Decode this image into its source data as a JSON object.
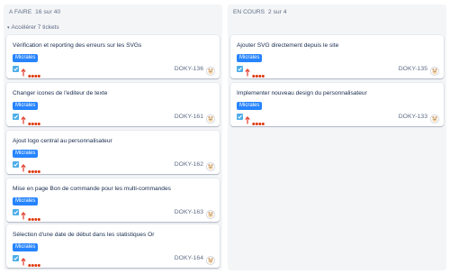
{
  "columns": [
    {
      "title": "A FAIRE",
      "count": "16 sur 40",
      "accelerate": "Accélérer 7 tickets",
      "cards": [
        {
          "summary": "Vérification et reporting des erreurs sur les SVGs",
          "label": "Micrales",
          "key": "DOKY-136"
        },
        {
          "summary": "Changer icones de l'editeur de texte",
          "label": "Micrales",
          "key": "DOKY-161"
        },
        {
          "summary": "Ajout logo central au personnalisateur",
          "label": "Micrales",
          "key": "DOKY-162"
        },
        {
          "summary": "Mise en page Bon de commande pour les multi-commandes",
          "label": "Micrales",
          "key": "DOKY-163"
        },
        {
          "summary": "Sélection d'une date de début dans les statistiques Or",
          "label": "Micrales",
          "key": "DOKY-164"
        }
      ]
    },
    {
      "title": "EN COURS",
      "count": "2 sur 4",
      "cards": [
        {
          "summary": "Ajouter SVG directement depuis le site",
          "label": "Micrales",
          "key": "DOKY-135"
        },
        {
          "summary": "Implementer nouveau design du personnalisateur",
          "label": "Micrales",
          "key": "DOKY-133"
        }
      ]
    }
  ],
  "icons": {
    "issue_type": "task-checkbox-icon",
    "priority": "priority-high-arrow-icon",
    "estimate": "story-points-dots-icon",
    "assignee": "avatar-icon"
  },
  "colors": {
    "label_bg": "#2684ff",
    "issue_type": "#4bade8",
    "priority": "#e5493a",
    "column_bg": "#f4f5f7"
  }
}
